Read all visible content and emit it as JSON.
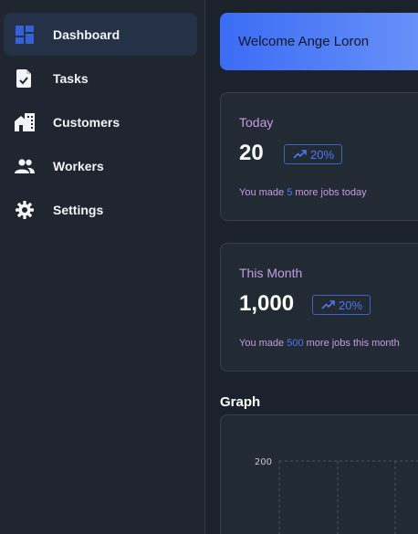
{
  "sidebar": {
    "items": [
      {
        "label": "Dashboard",
        "icon": "dashboard-icon",
        "active": true
      },
      {
        "label": "Tasks",
        "icon": "task-file-icon"
      },
      {
        "label": "Customers",
        "icon": "building-icon"
      },
      {
        "label": "Workers",
        "icon": "people-icon"
      },
      {
        "label": "Settings",
        "icon": "gear-icon"
      }
    ]
  },
  "welcome": {
    "text": "Welcome Ange Loron"
  },
  "cards": [
    {
      "title": "Today",
      "value": "20",
      "badge": "20%",
      "note_prefix": "You made ",
      "note_highlight": "5",
      "note_suffix": " more jobs today"
    },
    {
      "title": "This Month",
      "value": "1,000",
      "badge": "20%",
      "note_prefix": "You made ",
      "note_highlight": "500",
      "note_suffix": " more jobs this month"
    }
  ],
  "graph": {
    "title": "Graph",
    "y_tick_label": "200"
  },
  "colors": {
    "accent": "#3b6cf5",
    "card_title": "#c79be3",
    "sidebar_active": "#253147"
  }
}
